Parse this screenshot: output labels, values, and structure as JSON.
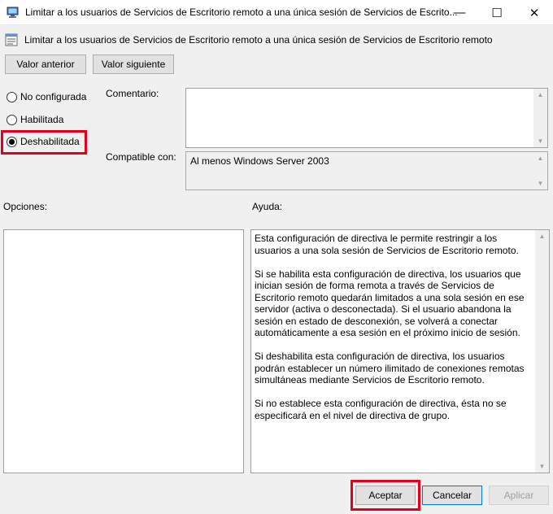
{
  "window": {
    "title": "Limitar a los usuarios de Servicios de Escritorio remoto a una única sesión de Servicios de Escrito...",
    "minimize_glyph": "—",
    "maximize_glyph": "☐",
    "close_glyph": "✕"
  },
  "header": {
    "policy_name": "Limitar a los usuarios de Servicios de Escritorio remoto a una única sesión de Servicios de Escritorio remoto",
    "prev_button": "Valor anterior",
    "next_button": "Valor siguiente"
  },
  "state": {
    "options": [
      {
        "label": "No configurada",
        "checked": false
      },
      {
        "label": "Habilitada",
        "checked": false
      },
      {
        "label": "Deshabilitada",
        "checked": true
      }
    ],
    "highlight_color": "#e3001b"
  },
  "comment": {
    "label": "Comentario:",
    "value": ""
  },
  "compatible": {
    "label": "Compatible con:",
    "value": "Al menos Windows Server 2003"
  },
  "options_panel": {
    "label": "Opciones:"
  },
  "help_panel": {
    "label": "Ayuda:",
    "paragraphs": [
      "Esta configuración de directiva le permite restringir a los usuarios a una sola sesión de Servicios de Escritorio remoto.",
      "Si se habilita esta configuración de directiva, los usuarios que inician sesión de forma remota a través de Servicios de Escritorio remoto quedarán limitados a una sola sesión en ese servidor (activa o desconectada). Si el usuario abandona la sesión en estado de desconexión, se volverá a conectar automáticamente a esa sesión en el próximo inicio de sesión.",
      "Si deshabilita esta configuración de directiva, los usuarios podrán establecer un número ilimitado de conexiones remotas simultáneas mediante Servicios de Escritorio remoto.",
      "Si no establece esta configuración de directiva, ésta no se especificará en el nivel de directiva de grupo."
    ]
  },
  "footer": {
    "ok_button": "Aceptar",
    "cancel_button": "Cancelar",
    "apply_button": "Aplicar"
  },
  "icons": {
    "app": "remote-desktop-policy-icon",
    "policy": "policy-setting-icon"
  }
}
